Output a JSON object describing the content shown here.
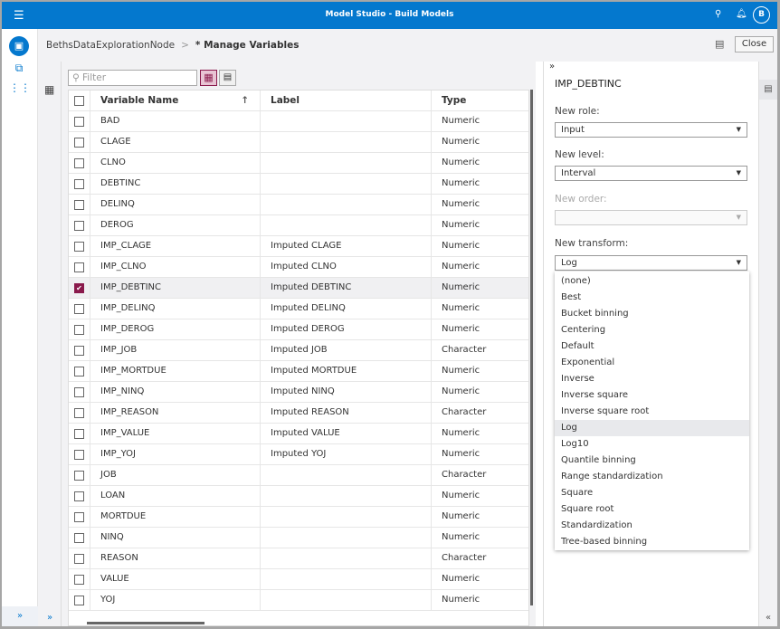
{
  "app": {
    "title": "Model Studio - Build Models",
    "avatar": "B"
  },
  "header": {
    "breadcrumb_parent": "BethsDataExplorationNode",
    "breadcrumb_sep": ">",
    "breadcrumb_current": "* Manage Variables",
    "close_label": "Close"
  },
  "filter": {
    "placeholder": "Filter"
  },
  "table": {
    "columns": [
      "Variable Name",
      "Label",
      "Type"
    ],
    "sort_indicator": "↑",
    "rows": [
      {
        "name": "BAD",
        "label": "",
        "type": "Numeric",
        "checked": false
      },
      {
        "name": "CLAGE",
        "label": "",
        "type": "Numeric",
        "checked": false
      },
      {
        "name": "CLNO",
        "label": "",
        "type": "Numeric",
        "checked": false
      },
      {
        "name": "DEBTINC",
        "label": "",
        "type": "Numeric",
        "checked": false
      },
      {
        "name": "DELINQ",
        "label": "",
        "type": "Numeric",
        "checked": false
      },
      {
        "name": "DEROG",
        "label": "",
        "type": "Numeric",
        "checked": false
      },
      {
        "name": "IMP_CLAGE",
        "label": "Imputed CLAGE",
        "type": "Numeric",
        "checked": false
      },
      {
        "name": "IMP_CLNO",
        "label": "Imputed CLNO",
        "type": "Numeric",
        "checked": false
      },
      {
        "name": "IMP_DEBTINC",
        "label": "Imputed DEBTINC",
        "type": "Numeric",
        "checked": true
      },
      {
        "name": "IMP_DELINQ",
        "label": "Imputed DELINQ",
        "type": "Numeric",
        "checked": false
      },
      {
        "name": "IMP_DEROG",
        "label": "Imputed DEROG",
        "type": "Numeric",
        "checked": false
      },
      {
        "name": "IMP_JOB",
        "label": "Imputed JOB",
        "type": "Character",
        "checked": false
      },
      {
        "name": "IMP_MORTDUE",
        "label": "Imputed MORTDUE",
        "type": "Numeric",
        "checked": false
      },
      {
        "name": "IMP_NINQ",
        "label": "Imputed NINQ",
        "type": "Numeric",
        "checked": false
      },
      {
        "name": "IMP_REASON",
        "label": "Imputed REASON",
        "type": "Character",
        "checked": false
      },
      {
        "name": "IMP_VALUE",
        "label": "Imputed VALUE",
        "type": "Numeric",
        "checked": false
      },
      {
        "name": "IMP_YOJ",
        "label": "Imputed YOJ",
        "type": "Numeric",
        "checked": false
      },
      {
        "name": "JOB",
        "label": "",
        "type": "Character",
        "checked": false
      },
      {
        "name": "LOAN",
        "label": "",
        "type": "Numeric",
        "checked": false
      },
      {
        "name": "MORTDUE",
        "label": "",
        "type": "Numeric",
        "checked": false
      },
      {
        "name": "NINQ",
        "label": "",
        "type": "Numeric",
        "checked": false
      },
      {
        "name": "REASON",
        "label": "",
        "type": "Character",
        "checked": false
      },
      {
        "name": "VALUE",
        "label": "",
        "type": "Numeric",
        "checked": false
      },
      {
        "name": "YOJ",
        "label": "",
        "type": "Numeric",
        "checked": false
      }
    ]
  },
  "properties": {
    "title": "IMP_DEBTINC",
    "role_label": "New role:",
    "role_value": "Input",
    "level_label": "New level:",
    "level_value": "Interval",
    "order_label": "New order:",
    "order_value": "",
    "transform_label": "New transform:",
    "transform_value": "Log",
    "transform_options": [
      "(none)",
      "Best",
      "Bucket binning",
      "Centering",
      "Default",
      "Exponential",
      "Inverse",
      "Inverse square",
      "Inverse square root",
      "Log",
      "Log10",
      "Quantile binning",
      "Range standardization",
      "Square",
      "Square root",
      "Standardization",
      "Tree-based binning"
    ]
  },
  "colors": {
    "brand": "#0478ce",
    "accent": "#8a1a4c"
  }
}
